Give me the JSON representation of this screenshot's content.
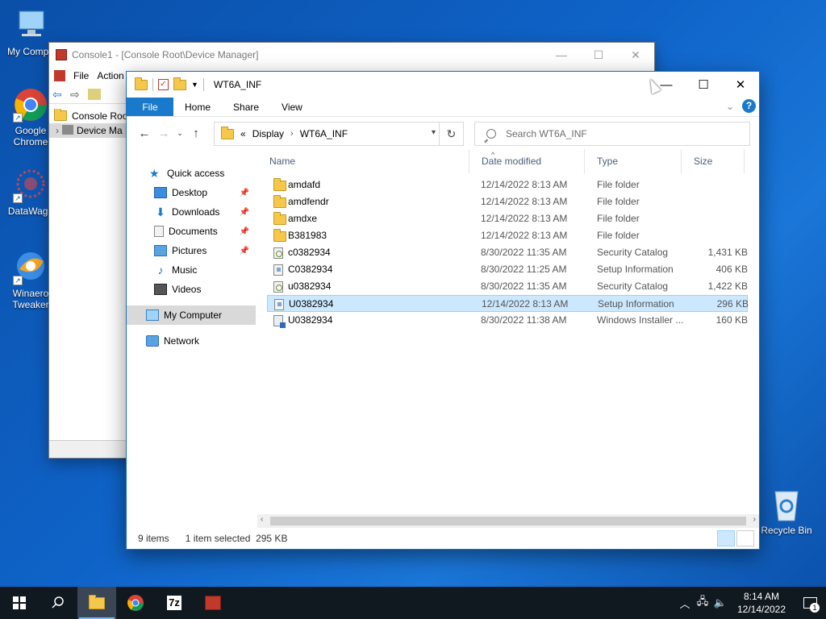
{
  "desktop": {
    "icons": [
      {
        "label": "My Compu",
        "icon": "computer-icon"
      },
      {
        "label": "Google Chrome",
        "icon": "chrome-icon"
      },
      {
        "label": "DataWago",
        "icon": "datawagon-icon"
      },
      {
        "label": "Winaero Tweaker",
        "icon": "winaero-tweaker-icon"
      },
      {
        "label": "Recycle Bin",
        "icon": "recycle-bin-icon"
      }
    ]
  },
  "console_window": {
    "title": "Console1 - [Console Root\\Device Manager]",
    "menu": [
      "File",
      "Action"
    ],
    "tree": [
      "Console Root",
      "Device Ma"
    ]
  },
  "explorer": {
    "title": "WT6A_INF",
    "ribbon_tabs": [
      "File",
      "Home",
      "Share",
      "View"
    ],
    "address": {
      "prefix": "«",
      "segments": [
        "Display",
        "WT6A_INF"
      ]
    },
    "search_placeholder": "Search WT6A_INF",
    "nav": {
      "quick_access": "Quick access",
      "pinned": [
        "Desktop",
        "Downloads",
        "Documents",
        "Pictures"
      ],
      "unpinned": [
        "Music",
        "Videos"
      ],
      "my_computer": "My Computer",
      "network": "Network"
    },
    "columns": {
      "name": "Name",
      "date": "Date modified",
      "type": "Type",
      "size": "Size"
    },
    "files": [
      {
        "name": "amdafd",
        "date": "12/14/2022 8:13 AM",
        "type": "File folder",
        "size": "",
        "kind": "folder"
      },
      {
        "name": "amdfendr",
        "date": "12/14/2022 8:13 AM",
        "type": "File folder",
        "size": "",
        "kind": "folder"
      },
      {
        "name": "amdxe",
        "date": "12/14/2022 8:13 AM",
        "type": "File folder",
        "size": "",
        "kind": "folder"
      },
      {
        "name": "B381983",
        "date": "12/14/2022 8:13 AM",
        "type": "File folder",
        "size": "",
        "kind": "folder"
      },
      {
        "name": "c0382934",
        "date": "8/30/2022 11:35 AM",
        "type": "Security Catalog",
        "size": "1,431 KB",
        "kind": "cat"
      },
      {
        "name": "C0382934",
        "date": "8/30/2022 11:25 AM",
        "type": "Setup Information",
        "size": "406 KB",
        "kind": "inf"
      },
      {
        "name": "u0382934",
        "date": "8/30/2022 11:35 AM",
        "type": "Security Catalog",
        "size": "1,422 KB",
        "kind": "cat"
      },
      {
        "name": "U0382934",
        "date": "12/14/2022 8:13 AM",
        "type": "Setup Information",
        "size": "296 KB",
        "kind": "inf",
        "selected": true
      },
      {
        "name": "U0382934",
        "date": "8/30/2022 11:38 AM",
        "type": "Windows Installer ...",
        "size": "160 KB",
        "kind": "msi"
      }
    ],
    "status": {
      "count": "9 items",
      "selection": "1 item selected",
      "size": "295 KB"
    }
  },
  "taskbar": {
    "apps": [
      "start-icon",
      "search-icon",
      "file-explorer-icon",
      "chrome-icon",
      "7zip-icon",
      "mmc-icon"
    ],
    "seven_zip_label": "7z",
    "time": "8:14 AM",
    "date": "12/14/2022",
    "notifications": "1"
  },
  "colors": {
    "accent": "#1979ca",
    "selection": "#cce8ff",
    "desktop": "#0f63c8",
    "taskbar": "#101820"
  }
}
